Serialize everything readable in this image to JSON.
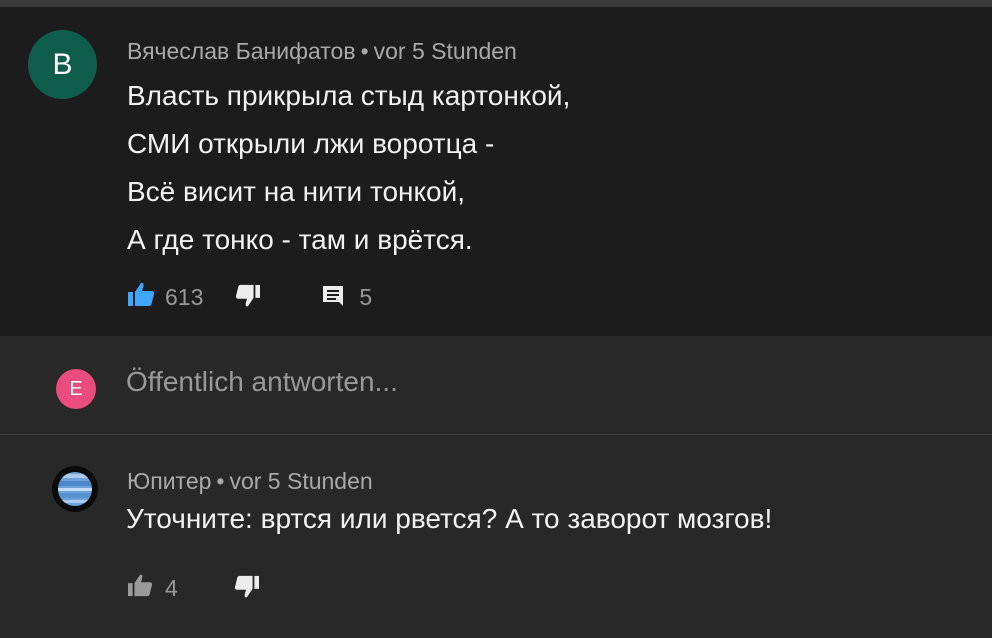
{
  "comment1": {
    "avatar_letter": "B",
    "author": "Вячеслав Банифатов",
    "separator": "•",
    "time": "vor 5 Stunden",
    "lines": [
      "Власть прикрыла стыд картонкой,",
      "СМИ открыли лжи воротца -",
      "Всё висит на нити тонкой,",
      "А где тонко - там и врётся."
    ],
    "likes": "613",
    "replies": "5"
  },
  "reply_box": {
    "avatar_letter": "E",
    "placeholder": "Öffentlich antworten..."
  },
  "comment2": {
    "author": "Юпитер",
    "separator": "•",
    "time": "vor 5 Stunden",
    "text": "Уточните: вртся или рвется? А то заворот мозгов!",
    "likes": "4"
  },
  "colors": {
    "avatar_b": "#0e5d4b",
    "avatar_e": "#ea4c7d",
    "like_active": "#3ea6ff"
  },
  "icons": [
    "thumb-up-icon",
    "thumb-down-icon",
    "comment-icon",
    "planet-icon"
  ]
}
